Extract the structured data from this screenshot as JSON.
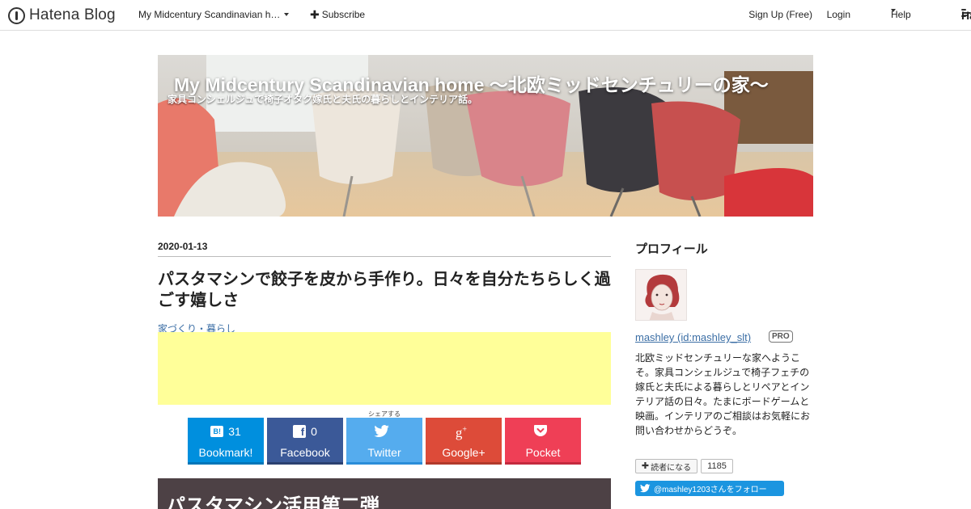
{
  "topbar": {
    "logo_text": "Hatena Blog",
    "blog_select": "My Midcentury Scandinavian h…",
    "subscribe": "Subscribe",
    "signup": "Sign Up (Free)",
    "login": "Login",
    "help": "Help",
    "hatena": "Hatena"
  },
  "header": {
    "title": "My Midcentury Scandinavian home 〜北欧ミッドセンチュリーの家〜",
    "description": "家具コンシェルジュで椅子オタク嫁氏と夫氏の暮らしとインテリア話。"
  },
  "entry": {
    "date": "2020-01-13",
    "title": "パスタマシンで餃子を皮から手作り。日々を自分たちらしく過ごす嬉しさ",
    "category": "家づくり・暮らし",
    "share_label": "シェアする",
    "section_heading": "パスタマシン活用第二弾"
  },
  "share": [
    {
      "name": "hatena",
      "count": "31",
      "label": "Bookmark!",
      "color": "#008fde",
      "bar": "#0076b8",
      "icon": "hatena-bookmark-icon"
    },
    {
      "name": "facebook",
      "count": "0",
      "label": "Facebook",
      "color": "#3b5998",
      "bar": "#2b4170",
      "icon": "facebook-icon"
    },
    {
      "name": "twitter",
      "count": "",
      "label": "Twitter",
      "color": "#55acee",
      "bar": "#2a8dd8",
      "icon": "twitter-icon"
    },
    {
      "name": "googleplus",
      "count": "",
      "label": "Google+",
      "color": "#dd4b39",
      "bar": "#b23a2b",
      "icon": "google-plus-icon"
    },
    {
      "name": "pocket",
      "count": "",
      "label": "Pocket",
      "color": "#ef3f56",
      "bar": "#c42a3e",
      "icon": "pocket-icon"
    }
  ],
  "sidebar": {
    "heading": "プロフィール",
    "name": "mashley (id:mashley_slt)",
    "badge": "PRO",
    "description": "北欧ミッドセンチュリーな家へようこそ。家具コンシェルジュで椅子フェチの嫁氏と夫氏による暮らしとリペアとインテリア話の日々。たまにボードゲームと映画。インテリアのご相談はお気軽にお問い合わせからどうぞ。",
    "reader_button": "読者になる",
    "reader_count": "1185",
    "follow_button": "@mashley1203さんをフォロー"
  }
}
